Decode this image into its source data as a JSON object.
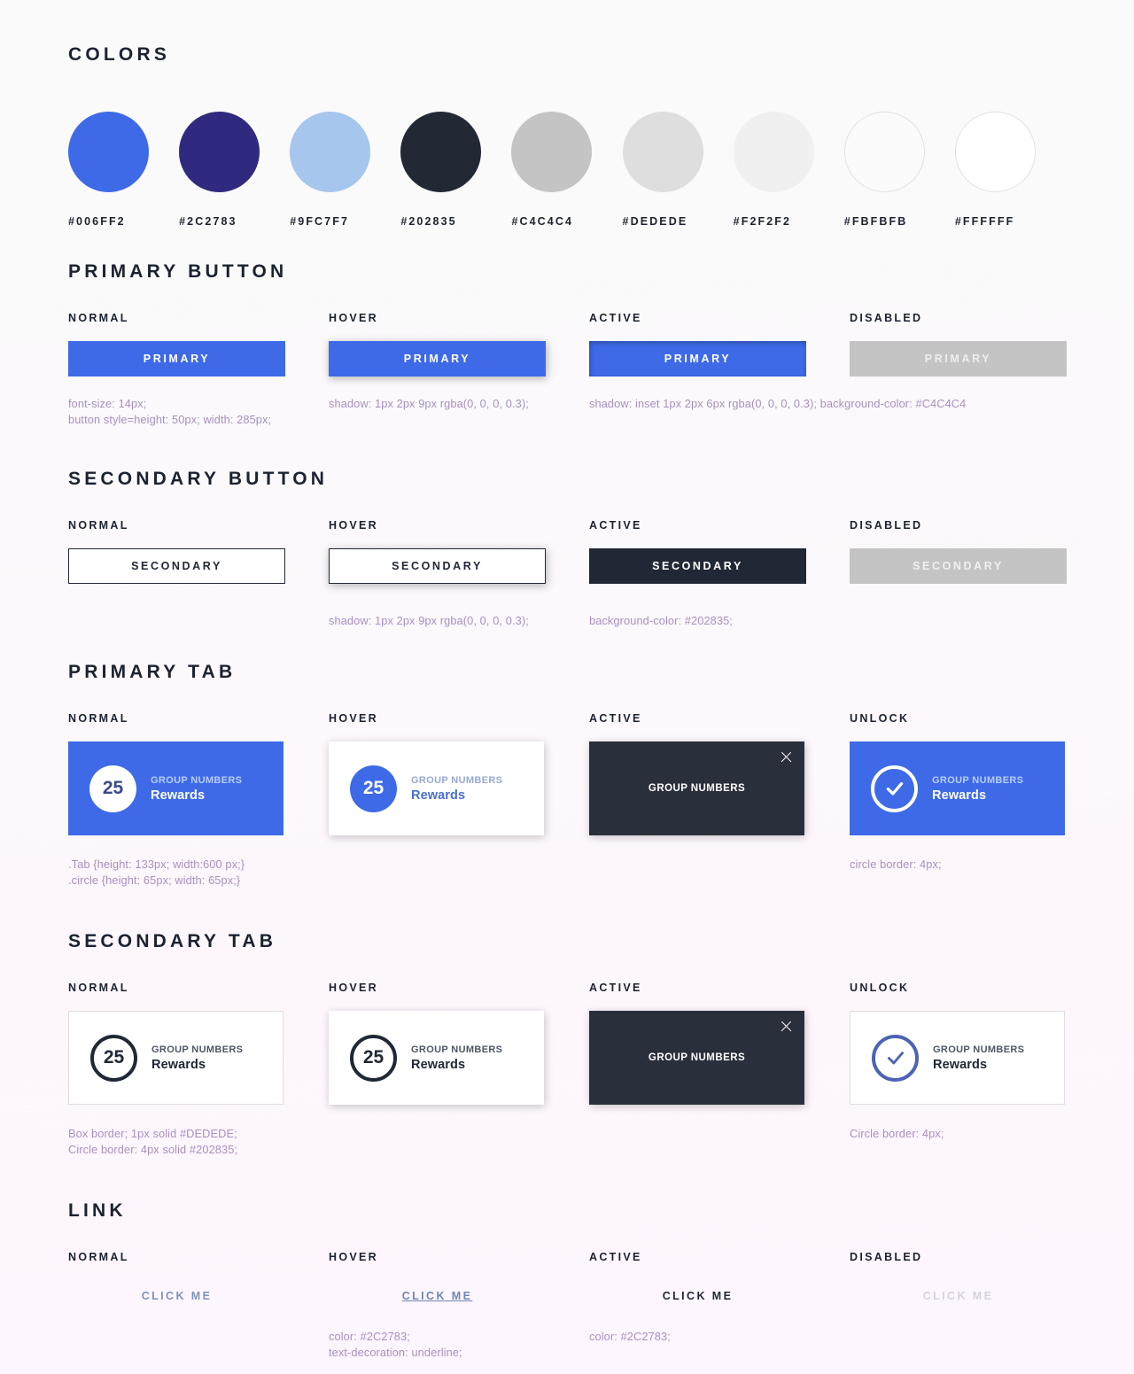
{
  "colors_section": {
    "title": "COLORS",
    "swatches": [
      {
        "hex": "#006FF2",
        "fill": "#3e6ae8",
        "border": "none"
      },
      {
        "hex": "#2C2783",
        "fill": "#2f2a7f",
        "border": "none"
      },
      {
        "hex": "#9FC7F7",
        "fill": "#a6c6ee",
        "border": "none"
      },
      {
        "hex": "#202835",
        "fill": "#222935",
        "border": "none"
      },
      {
        "hex": "#C4C4C4",
        "fill": "#c4c4c4",
        "border": "none"
      },
      {
        "hex": "#DEDEDE",
        "fill": "#dedede",
        "border": "none"
      },
      {
        "hex": "#F2F2F2",
        "fill": "#f0f0f0",
        "border": "none"
      },
      {
        "hex": "#FBFBFB",
        "fill": "#fbfbfb",
        "border": "1px solid #e2e2e2"
      },
      {
        "hex": "#FFFFFF",
        "fill": "#ffffff",
        "border": "1px solid #e2e2e2"
      }
    ]
  },
  "primary_button_section": {
    "title": "PRIMARY BUTTON",
    "states": [
      {
        "label": "NORMAL",
        "button_text": "PRIMARY",
        "note": "font-size: 14px;\nbutton style=height: 50px; width: 285px;"
      },
      {
        "label": "HOVER",
        "button_text": "PRIMARY",
        "note": "shadow: 1px 2px 9px rgba(0, 0, 0, 0.3);"
      },
      {
        "label": "ACTIVE",
        "button_text": "PRIMARY",
        "note": "shadow: inset 1px 2px 6px rgba(0, 0, 0, 0.3); background-color: #C4C4C4"
      },
      {
        "label": "DISABLED",
        "button_text": "PRIMARY",
        "note": ""
      }
    ]
  },
  "secondary_button_section": {
    "title": "SECONDARY BUTTON",
    "states": [
      {
        "label": "NORMAL",
        "button_text": "SECONDARY",
        "note": ""
      },
      {
        "label": "HOVER",
        "button_text": "SECONDARY",
        "note": "shadow: 1px 2px 9px rgba(0, 0, 0, 0.3);"
      },
      {
        "label": "ACTIVE",
        "button_text": "SECONDARY",
        "note": "background-color: #202835;"
      },
      {
        "label": "DISABLED",
        "button_text": "SECONDARY",
        "note": ""
      }
    ]
  },
  "primary_tab_section": {
    "title": "PRIMARY TAB",
    "states": [
      {
        "label": "NORMAL",
        "badge": "25",
        "eyebrow": "GROUP NUMBERS",
        "main": "Rewards",
        "note": ".Tab {height: 133px; width:600 px;}\n.circle {height: 65px; width: 65px;}"
      },
      {
        "label": "HOVER",
        "badge": "25",
        "eyebrow": "GROUP NUMBERS",
        "main": "Rewards",
        "note": ""
      },
      {
        "label": "ACTIVE",
        "center_label": "GROUP NUMBERS",
        "close_icon": "close-icon",
        "note": ""
      },
      {
        "label": "UNLOCK",
        "badge_icon": "check-icon",
        "eyebrow": "GROUP NUMBERS",
        "main": "Rewards",
        "note": "circle border: 4px;"
      }
    ]
  },
  "secondary_tab_section": {
    "title": "SECONDARY TAB",
    "states": [
      {
        "label": "NORMAL",
        "badge": "25",
        "eyebrow": "GROUP NUMBERS",
        "main": "Rewards",
        "note": "Box border; 1px solid #DEDEDE;\nCircle border: 4px solid #202835;"
      },
      {
        "label": "HOVER",
        "badge": "25",
        "eyebrow": "GROUP NUMBERS",
        "main": "Rewards",
        "note": ""
      },
      {
        "label": "ACTIVE",
        "center_label": "GROUP NUMBERS",
        "close_icon": "close-icon",
        "note": ""
      },
      {
        "label": "UNLOCK",
        "badge_icon": "check-icon",
        "eyebrow": "GROUP NUMBERS",
        "main": "Rewards",
        "note": "Circle border: 4px;"
      }
    ]
  },
  "link_section": {
    "title": "LINK",
    "states": [
      {
        "label": "NORMAL",
        "text": "CLICK ME",
        "note": ""
      },
      {
        "label": "HOVER",
        "text": "CLICK ME",
        "note": "color: #2C2783;\ntext-decoration: underline;"
      },
      {
        "label": "ACTIVE",
        "text": "CLICK ME",
        "note": "color: #2C2783;"
      },
      {
        "label": "DISABLED",
        "text": "CLICK ME",
        "note": ""
      }
    ]
  }
}
